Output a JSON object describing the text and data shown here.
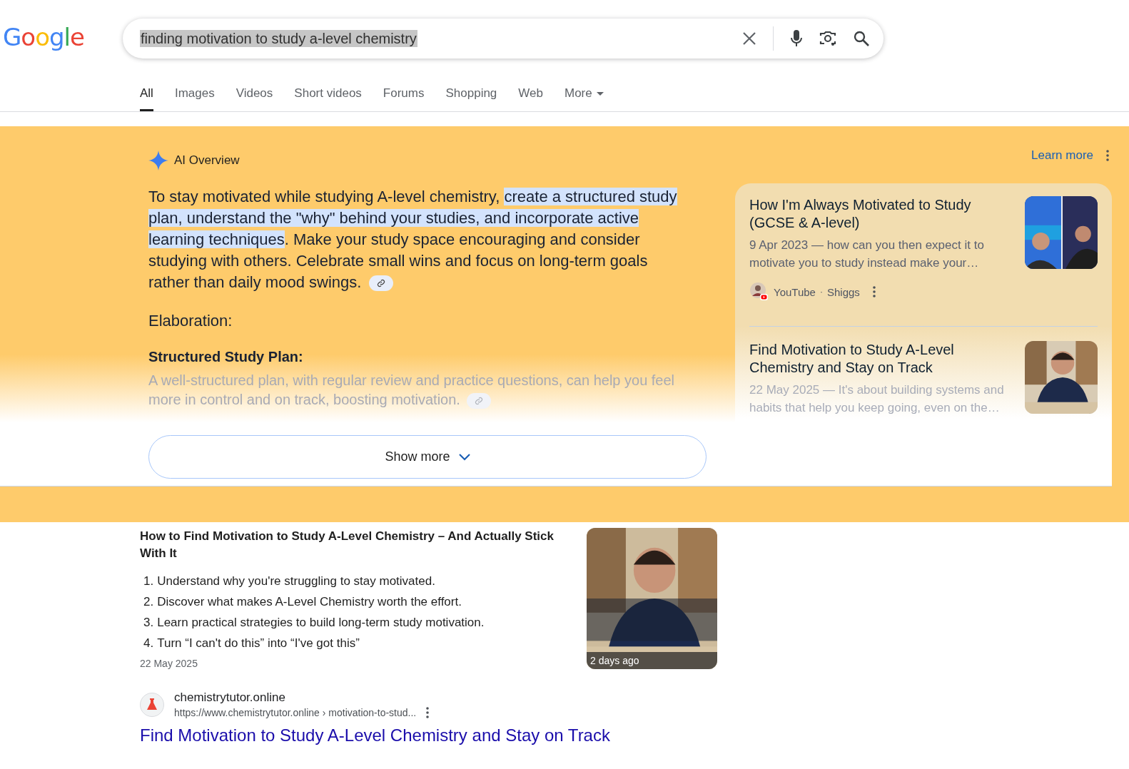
{
  "logo": "Google",
  "search": {
    "value": "finding motivation to study a-level chemistry"
  },
  "tabs": [
    {
      "label": "All",
      "selected": true,
      "kind": "tab"
    },
    {
      "label": "Images",
      "selected": false,
      "kind": "tab"
    },
    {
      "label": "Videos",
      "selected": false,
      "kind": "tab"
    },
    {
      "label": "Short videos",
      "selected": false,
      "kind": "tab"
    },
    {
      "label": "Forums",
      "selected": false,
      "kind": "tab"
    },
    {
      "label": "Shopping",
      "selected": false,
      "kind": "tab"
    },
    {
      "label": "Web",
      "selected": false,
      "kind": "tab"
    },
    {
      "label": "More",
      "selected": false,
      "kind": "menu"
    }
  ],
  "ai_overview": {
    "title": "AI Overview",
    "learn_more": "Learn more",
    "summary": [
      {
        "text": "To stay motivated while studying A-level chemistry, ",
        "highlighted": false
      },
      {
        "text": "create a structured study plan, understand the \"why\" behind your studies, and incorporate active learning techniques",
        "highlighted": true
      },
      {
        "text": ". Make your study space encouraging and consider studying with others. Celebrate small wins and focus on long-term goals rather than daily mood swings.",
        "highlighted": false
      }
    ],
    "heading": "Elaboration:",
    "subheading": "Structured Study Plan:",
    "detail": "A well-structured plan, with regular review and practice questions, can help you feel more in control and on track, boosting motivation.",
    "show_more": "Show more",
    "sources": [
      {
        "title": "How I'm Always Motivated to Study (GCSE & A-level)",
        "snippet": "9 Apr 2023 — how can you then expect it to motivate you to study instead make your…",
        "site": "YouTube",
        "separator": "·",
        "author": "Shiggs",
        "faded": false
      },
      {
        "title": "Find Motivation to Study A-Level Chemistry and Stay on Track",
        "snippet": "22 May 2025 — It's about building systems and habits that help you keep going, even on the…",
        "faded": true
      }
    ]
  },
  "result": {
    "title": "How to Find Motivation to Study A-Level Chemistry – And Actually Stick With It",
    "steps": [
      {
        "number": "1.",
        "text": "Understand why you're struggling to stay motivated."
      },
      {
        "number": "2.",
        "text": "Discover what makes A-Level Chemistry worth the effort."
      },
      {
        "number": "3.",
        "text": "Learn practical strategies to build long-term study motivation."
      },
      {
        "number": "4.",
        "text": "Turn “I can't do this” into “I've got this”"
      }
    ],
    "date": "22 May 2025",
    "thumbnail_label": "2 days ago",
    "site_name": "chemistrytutor.online",
    "url": "https://www.chemistrytutor.online › motivation-to-stud...",
    "link": "Find Motivation to Study A-Level Chemistry and Stay on Track"
  }
}
